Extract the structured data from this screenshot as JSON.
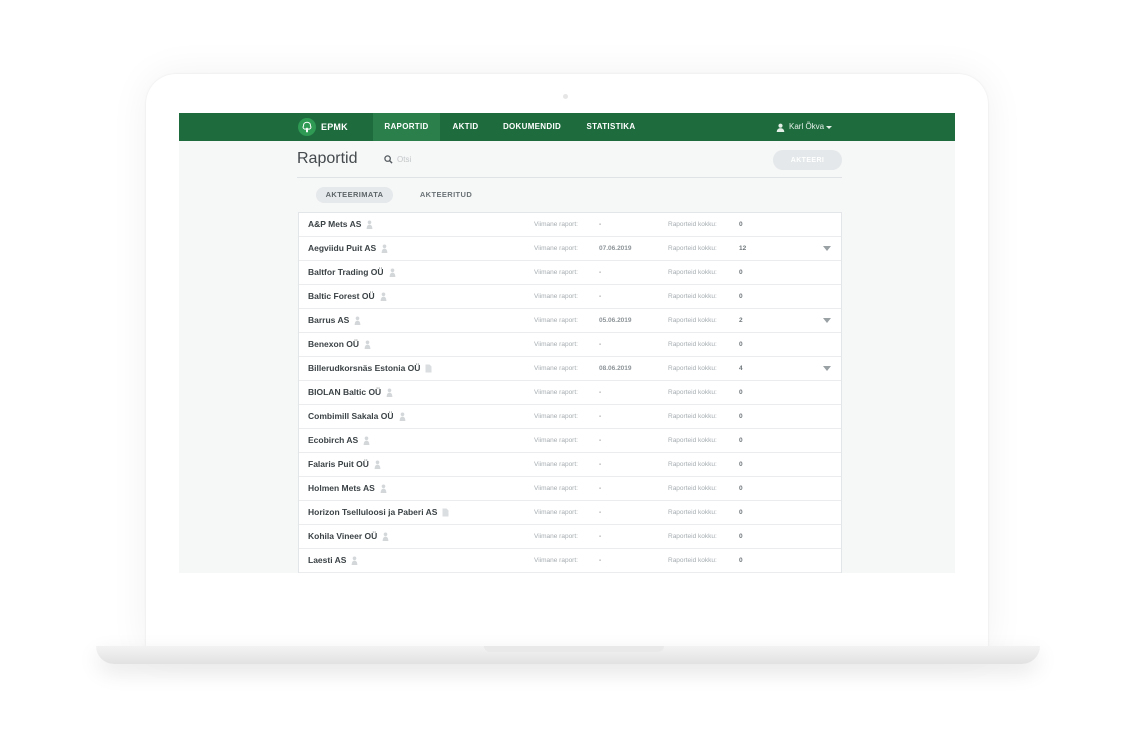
{
  "app": {
    "logo_text": "EPMK"
  },
  "nav": {
    "items": [
      {
        "label": "RAPORTID",
        "active": true
      },
      {
        "label": "AKTID"
      },
      {
        "label": "DOKUMENDID"
      },
      {
        "label": "STATISTIKA"
      }
    ],
    "user": "Karl Õkva"
  },
  "page": {
    "title": "Raportid",
    "search_placeholder": "Otsi",
    "action_button": "AKTEERI"
  },
  "tabs": [
    {
      "label": "AKTEERIMATA",
      "active": true
    },
    {
      "label": "AKTEERITUD"
    }
  ],
  "list": {
    "last_label": "Viimane raport:",
    "total_label": "Raporteid kokku:",
    "rows": [
      {
        "name": "A&P Mets AS",
        "icon": "person-icon",
        "last": "-",
        "total": "0",
        "expandable": false
      },
      {
        "name": "Aegviidu Puit AS",
        "icon": "person-icon",
        "last": "07.06.2019",
        "total": "12",
        "expandable": true
      },
      {
        "name": "Baltfor Trading OÜ",
        "icon": "person-icon",
        "last": "-",
        "total": "0",
        "expandable": false
      },
      {
        "name": "Baltic Forest OÜ",
        "icon": "person-icon",
        "last": "-",
        "total": "0",
        "expandable": false
      },
      {
        "name": "Barrus AS",
        "icon": "person-icon",
        "last": "05.06.2019",
        "total": "2",
        "expandable": true
      },
      {
        "name": "Benexon OÜ",
        "icon": "person-icon",
        "last": "-",
        "total": "0",
        "expandable": false
      },
      {
        "name": "Billerudkorsnäs Estonia OÜ",
        "icon": "document-icon",
        "last": "08.06.2019",
        "total": "4",
        "expandable": true
      },
      {
        "name": "BIOLAN Baltic OÜ",
        "icon": "person-icon",
        "last": "-",
        "total": "0",
        "expandable": false
      },
      {
        "name": "Combimill Sakala OÜ",
        "icon": "person-icon",
        "last": "-",
        "total": "0",
        "expandable": false
      },
      {
        "name": "Ecobirch AS",
        "icon": "person-icon",
        "last": "-",
        "total": "0",
        "expandable": false
      },
      {
        "name": "Falaris Puit OÜ",
        "icon": "person-icon",
        "last": "-",
        "total": "0",
        "expandable": false
      },
      {
        "name": "Holmen Mets AS",
        "icon": "person-icon",
        "last": "-",
        "total": "0",
        "expandable": false
      },
      {
        "name": "Horizon Tselluloosi ja Paberi AS",
        "icon": "document-icon",
        "last": "-",
        "total": "0",
        "expandable": false
      },
      {
        "name": "Kohila Vineer OÜ",
        "icon": "person-icon",
        "last": "-",
        "total": "0",
        "expandable": false
      },
      {
        "name": "Laesti AS",
        "icon": "person-icon",
        "last": "-",
        "total": "0",
        "expandable": false
      }
    ]
  },
  "colors": {
    "nav_bg": "#1e6b3e",
    "nav_active": "#2a7f4b",
    "page_bg": "#f6f7f7"
  }
}
